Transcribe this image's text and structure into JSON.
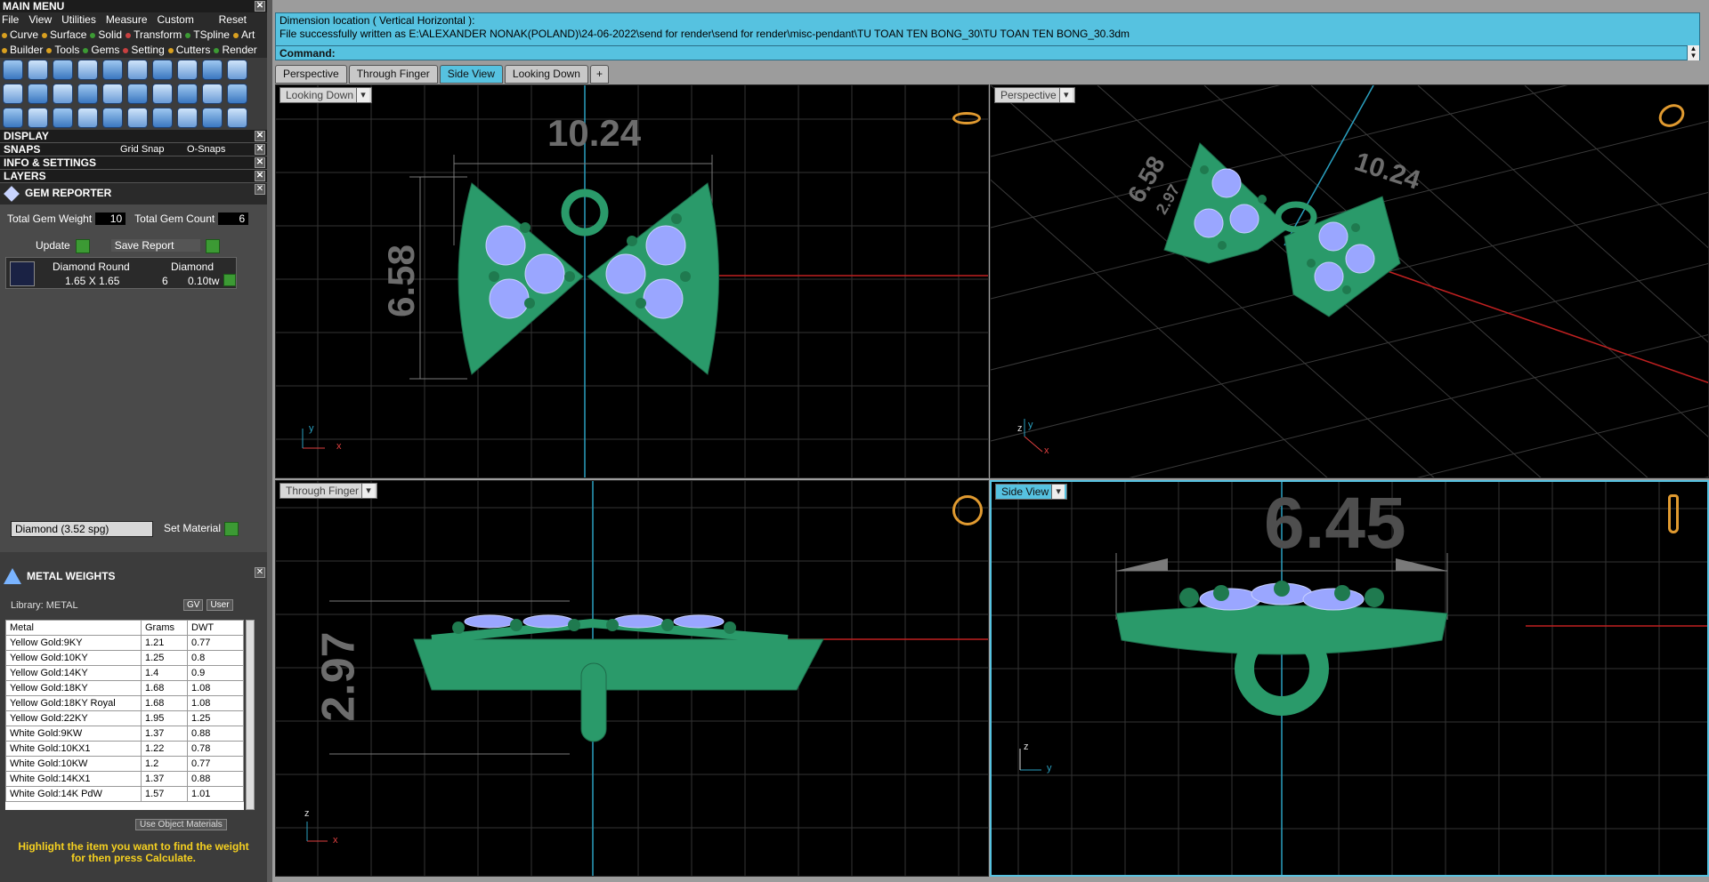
{
  "main_menu": {
    "title": "MAIN MENU",
    "menus": [
      "File",
      "View",
      "Utilities",
      "Measure",
      "Custom"
    ],
    "reset": "Reset",
    "categories_row1": [
      {
        "label": "Curve",
        "color": "#d9a020"
      },
      {
        "label": "Surface",
        "color": "#d9a020"
      },
      {
        "label": "Solid",
        "color": "#3c9a34"
      },
      {
        "label": "Transform",
        "color": "#c84040"
      },
      {
        "label": "TSpline",
        "color": "#3c9a34"
      },
      {
        "label": "Art",
        "color": "#d9a020"
      }
    ],
    "categories_row2": [
      {
        "label": "Builder",
        "color": "#d9a020"
      },
      {
        "label": "Tools",
        "color": "#d9a020"
      },
      {
        "label": "Gems",
        "color": "#3c9a34"
      },
      {
        "label": "Setting",
        "color": "#c84040"
      },
      {
        "label": "Cutters",
        "color": "#d9a020"
      },
      {
        "label": "Render",
        "color": "#3c9a34"
      }
    ]
  },
  "sections": {
    "display": "DISPLAY",
    "snaps": "SNAPS",
    "grid_snap": "Grid Snap",
    "o_snaps": "O-Snaps",
    "info": "INFO & SETTINGS",
    "layers": "LAYERS"
  },
  "gem_reporter": {
    "title": "GEM REPORTER",
    "total_weight_label": "Total Gem Weight",
    "total_weight_value": "10",
    "total_count_label": "Total Gem Count",
    "total_count_value": "6",
    "update_label": "Update",
    "save_label": "Save Report",
    "gem": {
      "shape": "Diamond Round",
      "material": "Diamond",
      "size": "1.65 X 1.65",
      "count": "6",
      "weight": "0.10tw"
    },
    "material_select": "Diamond    (3.52 spg)",
    "set_material": "Set Material"
  },
  "metal_weights": {
    "title": "METAL WEIGHTS",
    "library": "Library: METAL",
    "gv": "GV",
    "user": "User",
    "headers": [
      "Metal",
      "Grams",
      "DWT"
    ],
    "rows": [
      [
        "Yellow Gold:9KY",
        "1.21",
        "0.77"
      ],
      [
        "Yellow Gold:10KY",
        "1.25",
        "0.8"
      ],
      [
        "Yellow Gold:14KY",
        "1.4",
        "0.9"
      ],
      [
        "Yellow Gold:18KY",
        "1.68",
        "1.08"
      ],
      [
        "Yellow Gold:18KY Royal",
        "1.68",
        "1.08"
      ],
      [
        "Yellow Gold:22KY",
        "1.95",
        "1.25"
      ],
      [
        "White Gold:9KW",
        "1.37",
        "0.88"
      ],
      [
        "White Gold:10KX1",
        "1.22",
        "0.78"
      ],
      [
        "White Gold:10KW",
        "1.2",
        "0.77"
      ],
      [
        "White Gold:14KX1",
        "1.37",
        "0.88"
      ],
      [
        "White Gold:14K PdW",
        "1.57",
        "1.01"
      ]
    ],
    "use_object_materials": "Use Object Materials",
    "hint": "Highlight the item you want to find the weight for then press Calculate."
  },
  "command": {
    "line1": "Dimension location ( Vertical  Horizontal ):",
    "line2": "File successfully written as E:\\ALEXANDER NONAK(POLAND)\\24-06-2022\\send for render\\send for render\\misc-pendant\\TU TOAN TEN BONG_30\\TU TOAN TEN BONG_30.3dm",
    "label": "Command:"
  },
  "tabs": [
    "Perspective",
    "Through Finger",
    "Side View",
    "Looking Down"
  ],
  "add_tab": "+",
  "viewports": {
    "tl": {
      "label": "Looking Down",
      "dim1": "10.24",
      "dim2": "6.58",
      "axis_a": "y",
      "axis_b": "x"
    },
    "tr": {
      "label": "Perspective",
      "dim1": "6.58",
      "dim1b": "2.97",
      "dim2": "10.24",
      "axis_a": "z",
      "axis_b": "y",
      "axis_c": "x"
    },
    "bl": {
      "label": "Through Finger",
      "dim1": "2.97",
      "axis_a": "z",
      "axis_b": "x"
    },
    "br": {
      "label": "Side View",
      "dim1": "6.45",
      "axis_a": "z",
      "axis_b": "y"
    }
  },
  "colors": {
    "accent": "#56c2e0",
    "model": "#2a9a6a",
    "gem": "#9aa6ff",
    "grid": "#3a3a3a"
  }
}
